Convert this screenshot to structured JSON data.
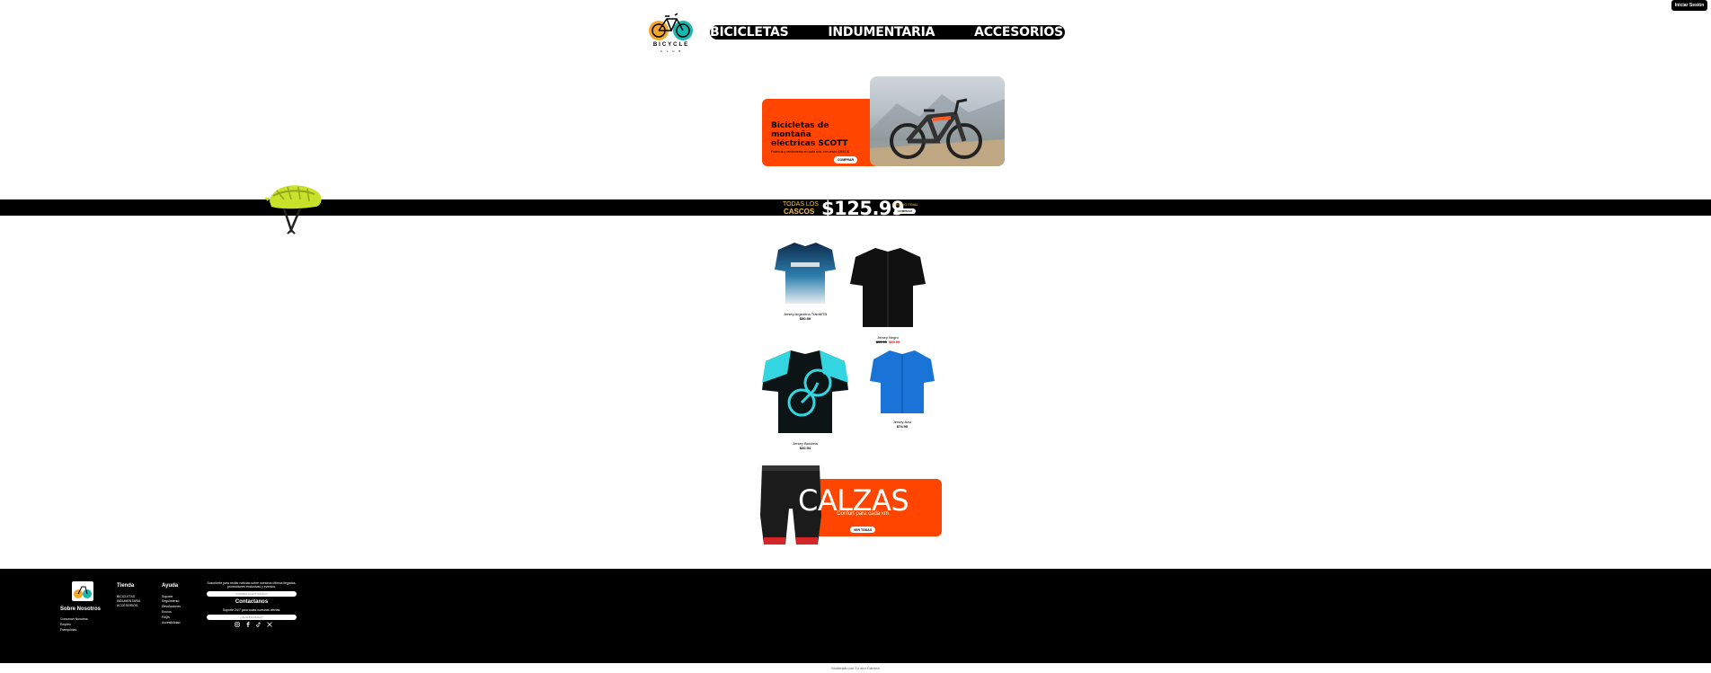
{
  "header": {
    "login_label": "Iniciar Sesión",
    "logo_text": "BICYCLE",
    "logo_sub": "C L U B",
    "nav": [
      "BICICLETAS",
      "INDUMENTARIA",
      "ACCESORIOS"
    ]
  },
  "promo": {
    "title": "Bicicletas de montaña eléctricas SCOTT",
    "desc": "Potencia y rendimiento en cada ruta, con envío GRATIS",
    "button": "COMPRAR"
  },
  "strip": {
    "small_text": "TODAS LOS",
    "cascos": "CASCOS",
    "price": "$125.99",
    "final_text": "PRECIO FINAL",
    "button": "COMPRAR"
  },
  "products": [
    {
      "name": "Jersey Argentina TrainMTB",
      "price": "$80.99"
    },
    {
      "name": "Jersey Negro",
      "old_price": "$99.99",
      "price": "$59.99"
    },
    {
      "name": "Jersey Bicicleta",
      "price": "$32.54"
    },
    {
      "name": "Jersey Azul",
      "price": "$74.90"
    }
  ],
  "calzas": {
    "title": "CALZAS",
    "subtitle": "Confort para cada km",
    "button": "VER TODAS"
  },
  "footer": {
    "about_title": "Sobre Nosotros",
    "about_links": [
      "Conozcan Nosotros",
      "Empleo",
      "Franquicias"
    ],
    "shop_title": "Tienda",
    "shop_links": [
      "BICICLETAS",
      "INDUMENTARIA",
      "ACCESORIOS"
    ],
    "help_title": "Ayuda",
    "help_links": [
      "Soporte",
      "Seguimiento",
      "Devoluciones",
      "Envíos",
      "FAQs",
      "Accesibilidad"
    ],
    "subscribe_text": "Suscribete para recibir noticias sobre nuestros últimos llegados, promociones exclusivas y eventos.",
    "email_placeholder": "CORREO ELECTRÓNICO",
    "contact_title": "Contactanos",
    "contact_text": "Soporte 24/7 para todas nuestras ofertas.",
    "question_placeholder": "¿ALGUNA DUDA?",
    "copyright": "Moderado por Tu otro Carrera"
  },
  "colors": {
    "accent": "#ff4500",
    "gold": "#f2c24b",
    "black": "#000000"
  }
}
